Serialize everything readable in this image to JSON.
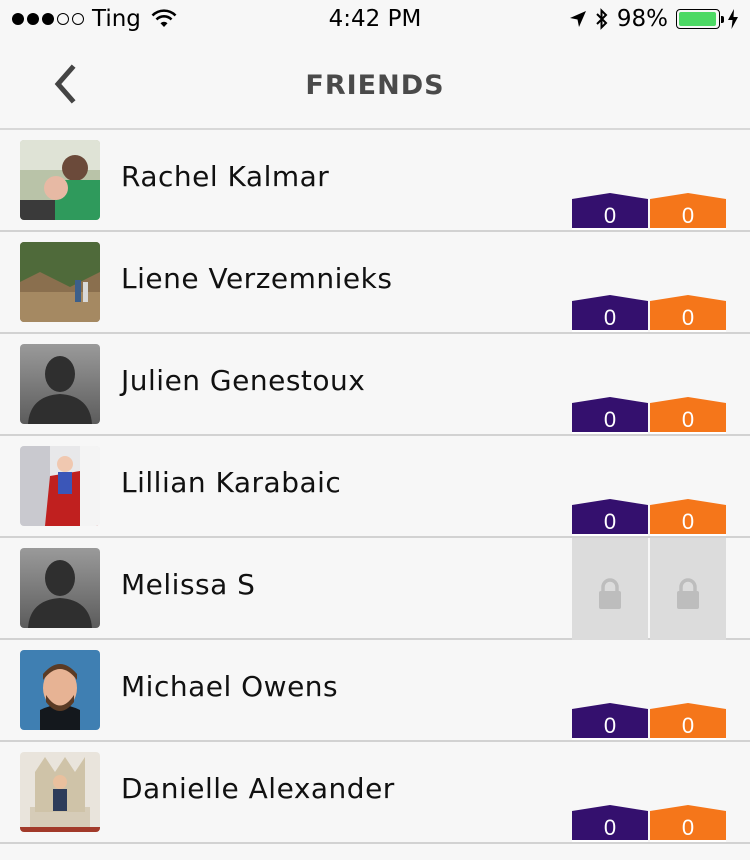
{
  "status_bar": {
    "carrier": "Ting",
    "time": "4:42 PM",
    "battery": "98%",
    "battery_level": 0.98,
    "signal_strength": 3,
    "icons": [
      "wifi-icon",
      "location-arrow-icon",
      "bluetooth-icon",
      "charging-bolt-icon"
    ]
  },
  "nav": {
    "title": "FRIENDS",
    "back_icon": "chevron-left-icon"
  },
  "colors": {
    "purple_badge": "#34106e",
    "orange_badge": "#f5761a",
    "battery_green": "#4cd964",
    "locked_cell": "#dcdcdc"
  },
  "friends": [
    {
      "name": "Rachel Kalmar",
      "avatar": "photo",
      "left_count": "0",
      "right_count": "0",
      "locked": false
    },
    {
      "name": "Liene Verzemnieks",
      "avatar": "photo",
      "left_count": "0",
      "right_count": "0",
      "locked": false
    },
    {
      "name": "Julien Genestoux",
      "avatar": "silhouette",
      "left_count": "0",
      "right_count": "0",
      "locked": false
    },
    {
      "name": "Lillian Karabaic",
      "avatar": "photo",
      "left_count": "0",
      "right_count": "0",
      "locked": false
    },
    {
      "name": "Melissa S",
      "avatar": "silhouette",
      "left_count": "",
      "right_count": "",
      "locked": true
    },
    {
      "name": "Michael Owens",
      "avatar": "photo",
      "left_count": "0",
      "right_count": "0",
      "locked": false
    },
    {
      "name": "Danielle Alexander",
      "avatar": "photo",
      "left_count": "0",
      "right_count": "0",
      "locked": false
    }
  ]
}
